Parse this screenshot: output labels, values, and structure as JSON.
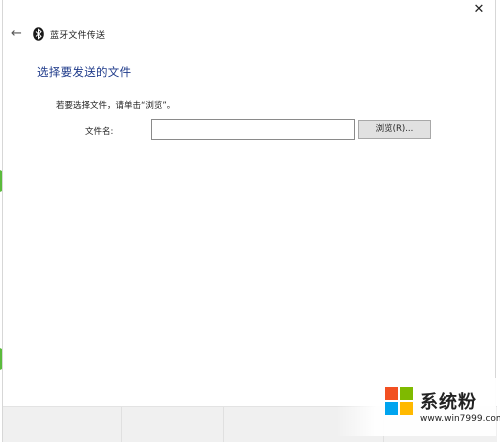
{
  "window": {
    "title": "蓝牙文件传送",
    "close_glyph": "✕",
    "back_glyph": "←"
  },
  "main": {
    "heading": "选择要发送的文件",
    "instruction": "若要选择文件，请单击“浏览”。",
    "file_label": "文件名:",
    "file_value": "",
    "browse_label": "浏览(R)..."
  },
  "watermark": {
    "name": "系统粉",
    "url": "www.win7999.com"
  },
  "icons": {
    "back": "back-arrow-icon",
    "bluetooth": "bluetooth-icon",
    "close": "close-icon",
    "logo": "windows-logo-icon"
  },
  "colors": {
    "heading": "#1e3a8a",
    "green_marker": "#5bbb3c",
    "logo_red": "#f25022",
    "logo_green": "#7fba00",
    "logo_blue": "#00a4ef",
    "logo_yellow": "#ffb900"
  }
}
